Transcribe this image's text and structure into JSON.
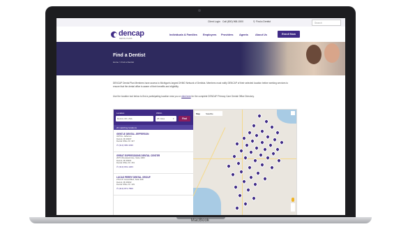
{
  "laptop": {
    "brand": "MacBook"
  },
  "utility": {
    "links": [
      "Client Login",
      "Call (800) 968-1500",
      "Find a Dentist"
    ],
    "search_placeholder": "Search"
  },
  "header": {
    "logo": "dencap",
    "logo_sub": "DENTAL PLANS",
    "nav": [
      "Individuals & Families",
      "Employers",
      "Providers",
      "Agents",
      "About Us"
    ],
    "cta": "Enroll Now"
  },
  "hero": {
    "title": "Find a Dentist",
    "breadcrumb": "Home  >  Find a Dentist"
  },
  "intro": {
    "p1": "DENCAP Dental Plan Members have access to Michigan's largest DHMO Network of Dentists. Members must notify DENCAP of their selected location before seeking services to ensure that the dental office is aware of their benefits and eligibility.",
    "p2a": "Use the location tool below to find a participating location near you or ",
    "p2link": "click here",
    "p2b": " for the complete DENCAP Primary Care Dental Office Directory."
  },
  "locator": {
    "location_label": "Location",
    "location_value": "Detroit, MI, USA",
    "within_label": "Within",
    "within_value": "25 miles",
    "find_label": "Find",
    "count_text": "20 matching locations",
    "results": [
      {
        "name": "GENTLE DENTAL JEFFERSON",
        "address": [
          "3476 E. Jefferson",
          "Detroit, MI 48207",
          "Dental Office ID: 327"
        ],
        "phone": "(313) 965-3336"
      },
      {
        "name": "GREAT EXPRESSIONS DENTAL CENTER",
        "address": [
          "2670 Woodward Ave, Suite 1000",
          "Detroit, MI 48201",
          "Dental Office ID: 153"
        ],
        "phone": "(313) 831-1463"
      },
      {
        "name": "LUCAS PERRY DENTAL GROUP",
        "address": [
          "2712 W. Grand Blvd, Suite 308",
          "Detroit, MI 48202",
          "Dental Office ID: 139"
        ],
        "phone": "(313) 871-7500"
      }
    ]
  },
  "map": {
    "tabs": [
      "Map",
      "Satellite"
    ]
  }
}
